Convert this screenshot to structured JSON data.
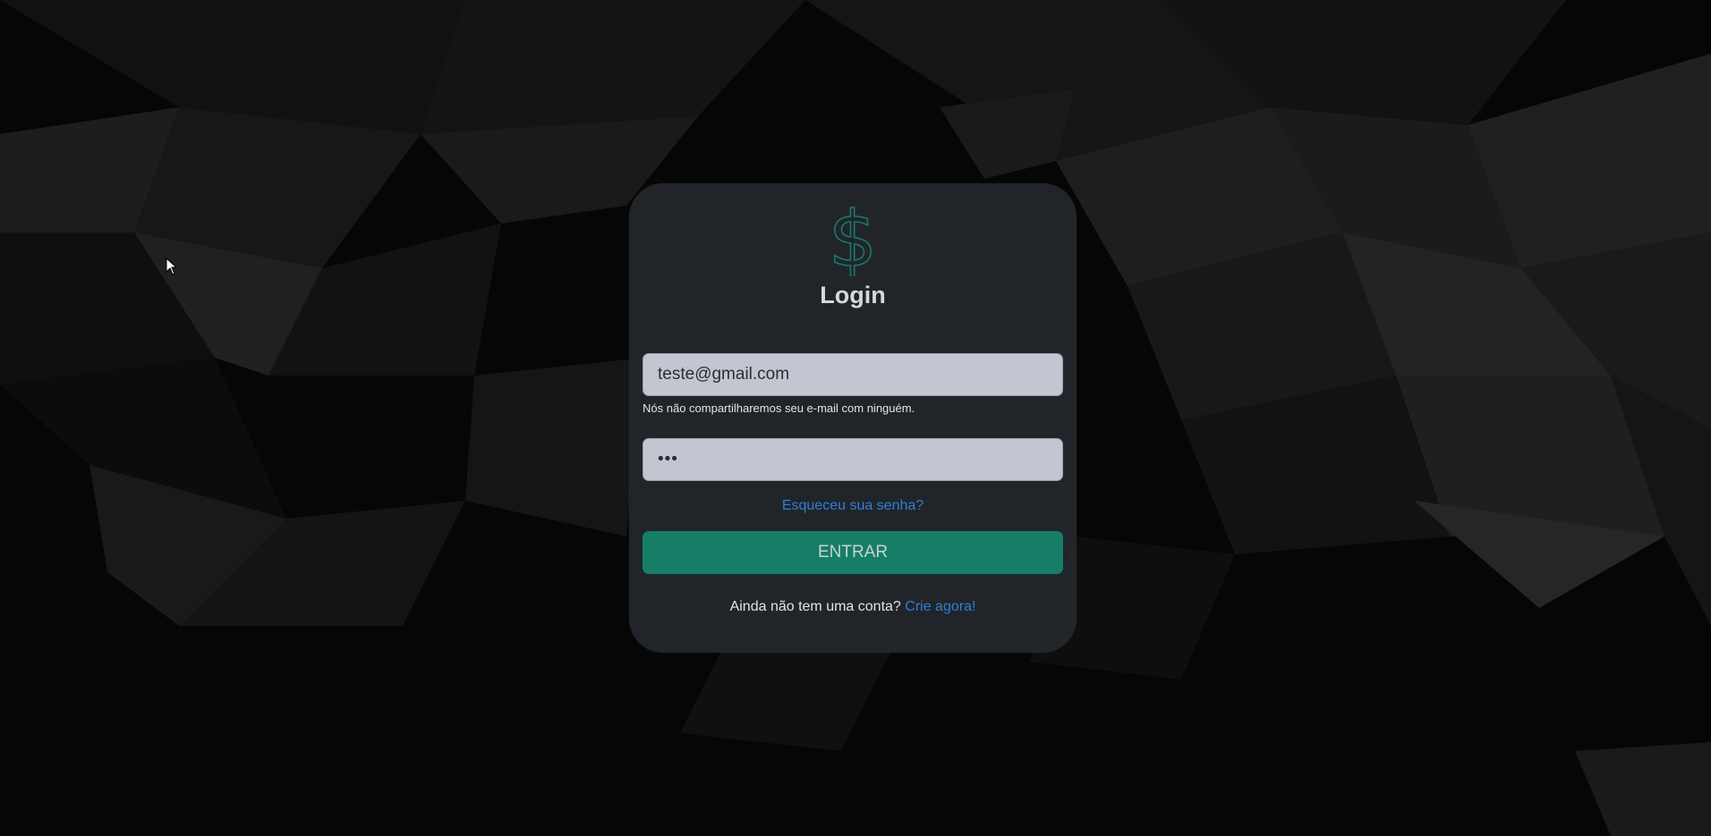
{
  "login": {
    "title": "Login",
    "email_value": "teste@gmail.com",
    "email_help": "Nós não compartilharemos seu e-mail com ninguém.",
    "password_value": "•••",
    "forgot_link": "Esqueceu sua senha?",
    "submit_label": "ENTRAR",
    "signup_prompt": "Ainda não tem uma conta?",
    "signup_link": "Crie agora!"
  },
  "icons": {
    "logo": "dollar-sign-icon",
    "cursor": "mouse-pointer-icon"
  },
  "colors": {
    "background": "#060606",
    "card": "#24282c",
    "accent": "#167e67",
    "link": "#2f7fd8",
    "input": "#c3c6d0"
  }
}
